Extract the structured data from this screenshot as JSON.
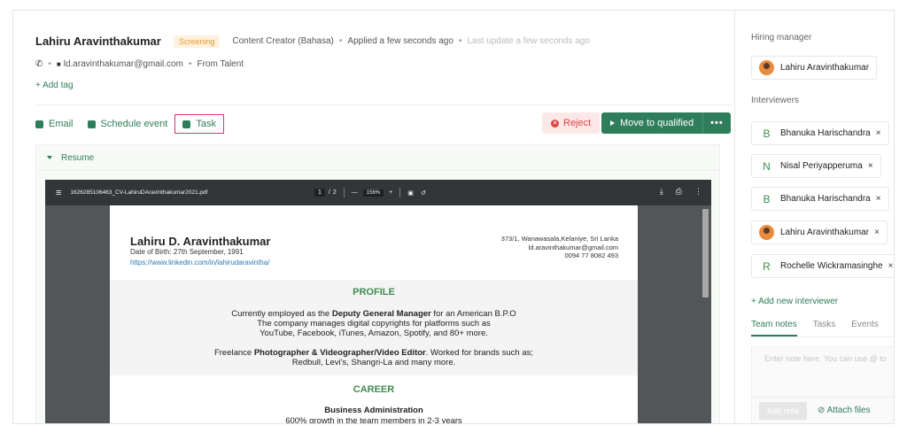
{
  "candidate": {
    "name": "Lahiru Aravinthakumar",
    "stage": "Screening",
    "role": "Content Creator (Bahasa)",
    "applied": "Applied a few seconds ago",
    "last_update": "Last update a few seconds ago",
    "email": "ld.aravinthakumar@gmail.com",
    "source": "From Talent",
    "add_tag": "+ Add tag"
  },
  "actions": {
    "email": "Email",
    "schedule": "Schedule event",
    "task": "Task",
    "reject": "Reject",
    "move": "Move to qualified",
    "more": "•••"
  },
  "resume": {
    "label": "Resume",
    "viewer": {
      "filename": "1626285106463_CV-LahiruDAravinthakumar2021.pdf",
      "page_current": "1",
      "page_sep": "/",
      "page_total": "2",
      "zoom": "156%"
    },
    "doc": {
      "name": "Lahiru D. Aravinthakumar",
      "dob": "Date of Birth: 27th September, 1991",
      "link": "https://www.linkedin.com/in/lahirudaravintha/",
      "address": "373/1, Wanawasala,Kelaniye, Sri Lanka",
      "email": "ld.aravinthakumar@gmail.com",
      "phone": "0094 77 8082 493",
      "profile_heading": "PROFILE",
      "p1_a": "Currently employed as the ",
      "p1_b": "Deputy General Manager",
      "p1_c": " for an American B.P.O",
      "p2": "The company manages digital copyrights for platforms such as",
      "p3": "YouTube, Facebook, iTunes, Amazon, Spotify, and 80+ more.",
      "p4_a": "Freelance ",
      "p4_b": "Photographer & Videographer/Video Editor",
      "p4_c": ". Worked for brands such as;",
      "p5": "Redbull, Levi's, Shangri-La and many more.",
      "career_heading": "CAREER",
      "career_title": "Business Administration",
      "career_line": "600% growth in the team members in 2-3 years"
    }
  },
  "sidebar": {
    "hiring_manager_label": "Hiring manager",
    "hiring_manager": "Lahiru Aravinthakumar",
    "interviewers_label": "Interviewers",
    "interviewers": [
      {
        "initial": "B",
        "name": "Bhanuka Harischandra"
      },
      {
        "initial": "N",
        "name": "Nisal Periyapperuma"
      },
      {
        "initial": "B",
        "name": "Bhanuka Harischandra"
      },
      {
        "initial": "",
        "name": "Lahiru Aravinthakumar"
      },
      {
        "initial": "R",
        "name": "Rochelle Wickramasinghe"
      }
    ],
    "remove": "×",
    "add_interviewer": "+ Add new interviewer",
    "tabs": [
      "Team notes",
      "Tasks",
      "Events"
    ],
    "note_placeholder": "Enter note here. You can use @ to",
    "add_note": "Add note",
    "attach": "Attach files"
  }
}
